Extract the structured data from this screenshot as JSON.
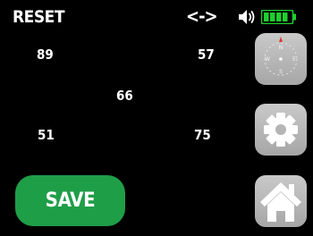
{
  "header": {
    "reset_label": "RESET",
    "swap_label": "<->"
  },
  "status": {
    "speaker_icon": "speaker-on-icon",
    "battery_icon": "battery-full-icon",
    "battery_color": "#1fcf2e"
  },
  "readings": {
    "r1": "89",
    "r2": "57",
    "r3": "66",
    "r4": "51",
    "r5": "75"
  },
  "side_buttons": {
    "compass_icon": "compass-icon",
    "compass_letters": {
      "n": "N",
      "s": "S",
      "e": "E",
      "w": "W"
    },
    "settings_icon": "gear-icon",
    "home_icon": "home-icon"
  },
  "save": {
    "label": "SAVE",
    "color": "#1f9e48"
  }
}
